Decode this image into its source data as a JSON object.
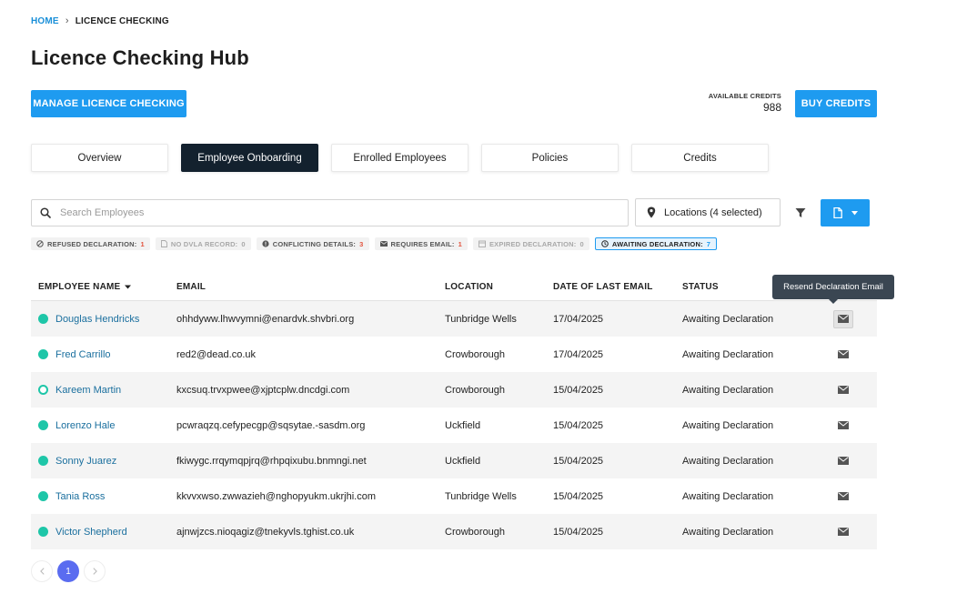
{
  "breadcrumb": {
    "home": "HOME",
    "current": "LICENCE CHECKING"
  },
  "page_title": "Licence Checking Hub",
  "actions": {
    "manage_label": "MANAGE LICENCE CHECKING",
    "buy_label": "BUY CREDITS"
  },
  "credits": {
    "label": "AVAILABLE CREDITS",
    "value": "988"
  },
  "tabs": [
    {
      "label": "Overview",
      "active": false
    },
    {
      "label": "Employee Onboarding",
      "active": true
    },
    {
      "label": "Enrolled Employees",
      "active": false
    },
    {
      "label": "Policies",
      "active": false
    },
    {
      "label": "Credits",
      "active": false
    }
  ],
  "search": {
    "placeholder": "Search Employees",
    "value": ""
  },
  "locations": {
    "label": "Locations (4 selected)"
  },
  "chips": [
    {
      "label": "REFUSED DECLARATION:",
      "count": "1",
      "icon": "ban-icon"
    },
    {
      "label": "NO DVLA RECORD:",
      "count": "0",
      "icon": "document-icon"
    },
    {
      "label": "CONFLICTING DETAILS:",
      "count": "3",
      "icon": "alert-icon"
    },
    {
      "label": "REQUIRES EMAIL:",
      "count": "1",
      "icon": "envelope-icon"
    },
    {
      "label": "EXPIRED DECLARATION:",
      "count": "0",
      "icon": "calendar-icon"
    },
    {
      "label": "AWAITING DECLARATION:",
      "count": "7",
      "icon": "clock-icon"
    }
  ],
  "table": {
    "columns": [
      "EMPLOYEE NAME",
      "EMAIL",
      "LOCATION",
      "DATE OF LAST EMAIL",
      "STATUS"
    ],
    "rows": [
      {
        "name": "Douglas Hendricks",
        "email": "ohhdyww.lhwvymni@enardvk.shvbri.org",
        "location": "Tunbridge Wells",
        "date": "17/04/2025",
        "status": "Awaiting Declaration"
      },
      {
        "name": "Fred Carrillo",
        "email": "red2@dead.co.uk",
        "location": "Crowborough",
        "date": "17/04/2025",
        "status": "Awaiting Declaration"
      },
      {
        "name": "Kareem Martin",
        "email": "kxcsuq.trvxpwee@xjptcplw.dncdgi.com",
        "location": "Crowborough",
        "date": "15/04/2025",
        "status": "Awaiting Declaration"
      },
      {
        "name": "Lorenzo Hale",
        "email": "pcwraqzq.cefypecgp@sqsytae.-sasdm.org",
        "location": "Uckfield",
        "date": "15/04/2025",
        "status": "Awaiting Declaration"
      },
      {
        "name": "Sonny Juarez",
        "email": "fkiwygc.rrqymqpjrq@rhpqixubu.bnmngi.net",
        "location": "Uckfield",
        "date": "15/04/2025",
        "status": "Awaiting Declaration"
      },
      {
        "name": "Tania Ross",
        "email": "kkvvxwso.zwwazieh@nghopyukm.ukrjhi.com",
        "location": "Tunbridge Wells",
        "date": "15/04/2025",
        "status": "Awaiting Declaration"
      },
      {
        "name": "Victor Shepherd",
        "email": "ajnwjzcs.nioqagiz@tnekyvls.tghist.co.uk",
        "location": "Crowborough",
        "date": "15/04/2025",
        "status": "Awaiting Declaration"
      }
    ]
  },
  "tooltip": "Resend Declaration Email",
  "pagination": {
    "current": "1"
  },
  "colors": {
    "accent": "#1e9bf0",
    "active_tab": "#13212e",
    "status_dot": "#1ec6a8",
    "page_active": "#5a6cf0"
  }
}
